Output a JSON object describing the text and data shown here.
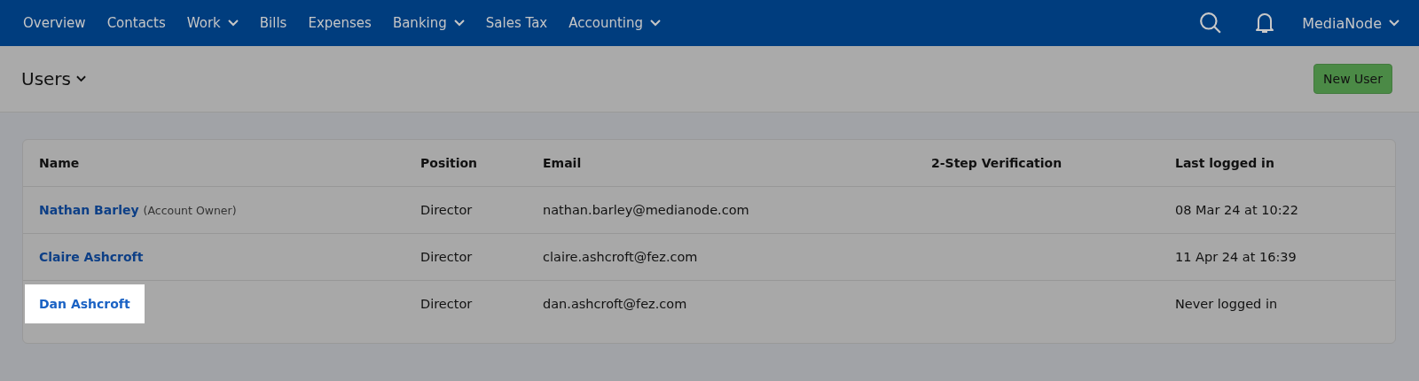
{
  "nav": {
    "items": [
      {
        "label": "Overview",
        "dropdown": false
      },
      {
        "label": "Contacts",
        "dropdown": false
      },
      {
        "label": "Work",
        "dropdown": true
      },
      {
        "label": "Bills",
        "dropdown": false
      },
      {
        "label": "Expenses",
        "dropdown": false
      },
      {
        "label": "Banking",
        "dropdown": true
      },
      {
        "label": "Sales Tax",
        "dropdown": false
      },
      {
        "label": "Accounting",
        "dropdown": true
      }
    ],
    "account": "MediaNode"
  },
  "page": {
    "title": "Users",
    "new_button": "New User"
  },
  "table": {
    "columns": [
      "Name",
      "Position",
      "Email",
      "2-Step Verification",
      "Last logged in"
    ],
    "rows": [
      {
        "name": "Nathan Barley",
        "note": "(Account Owner)",
        "position": "Director",
        "email": "nathan.barley@medianode.com",
        "last_login": "08 Mar 24 at 10:22",
        "highlighted": false
      },
      {
        "name": "Claire Ashcroft",
        "position": "Director",
        "email": "claire.ashcroft@fez.com",
        "last_login": "11 Apr 24 at 16:39",
        "highlighted": false
      },
      {
        "name": "Dan Ashcroft",
        "position": "Director",
        "email": "dan.ashcroft@fez.com",
        "last_login": "Never logged in",
        "highlighted": true
      }
    ]
  }
}
